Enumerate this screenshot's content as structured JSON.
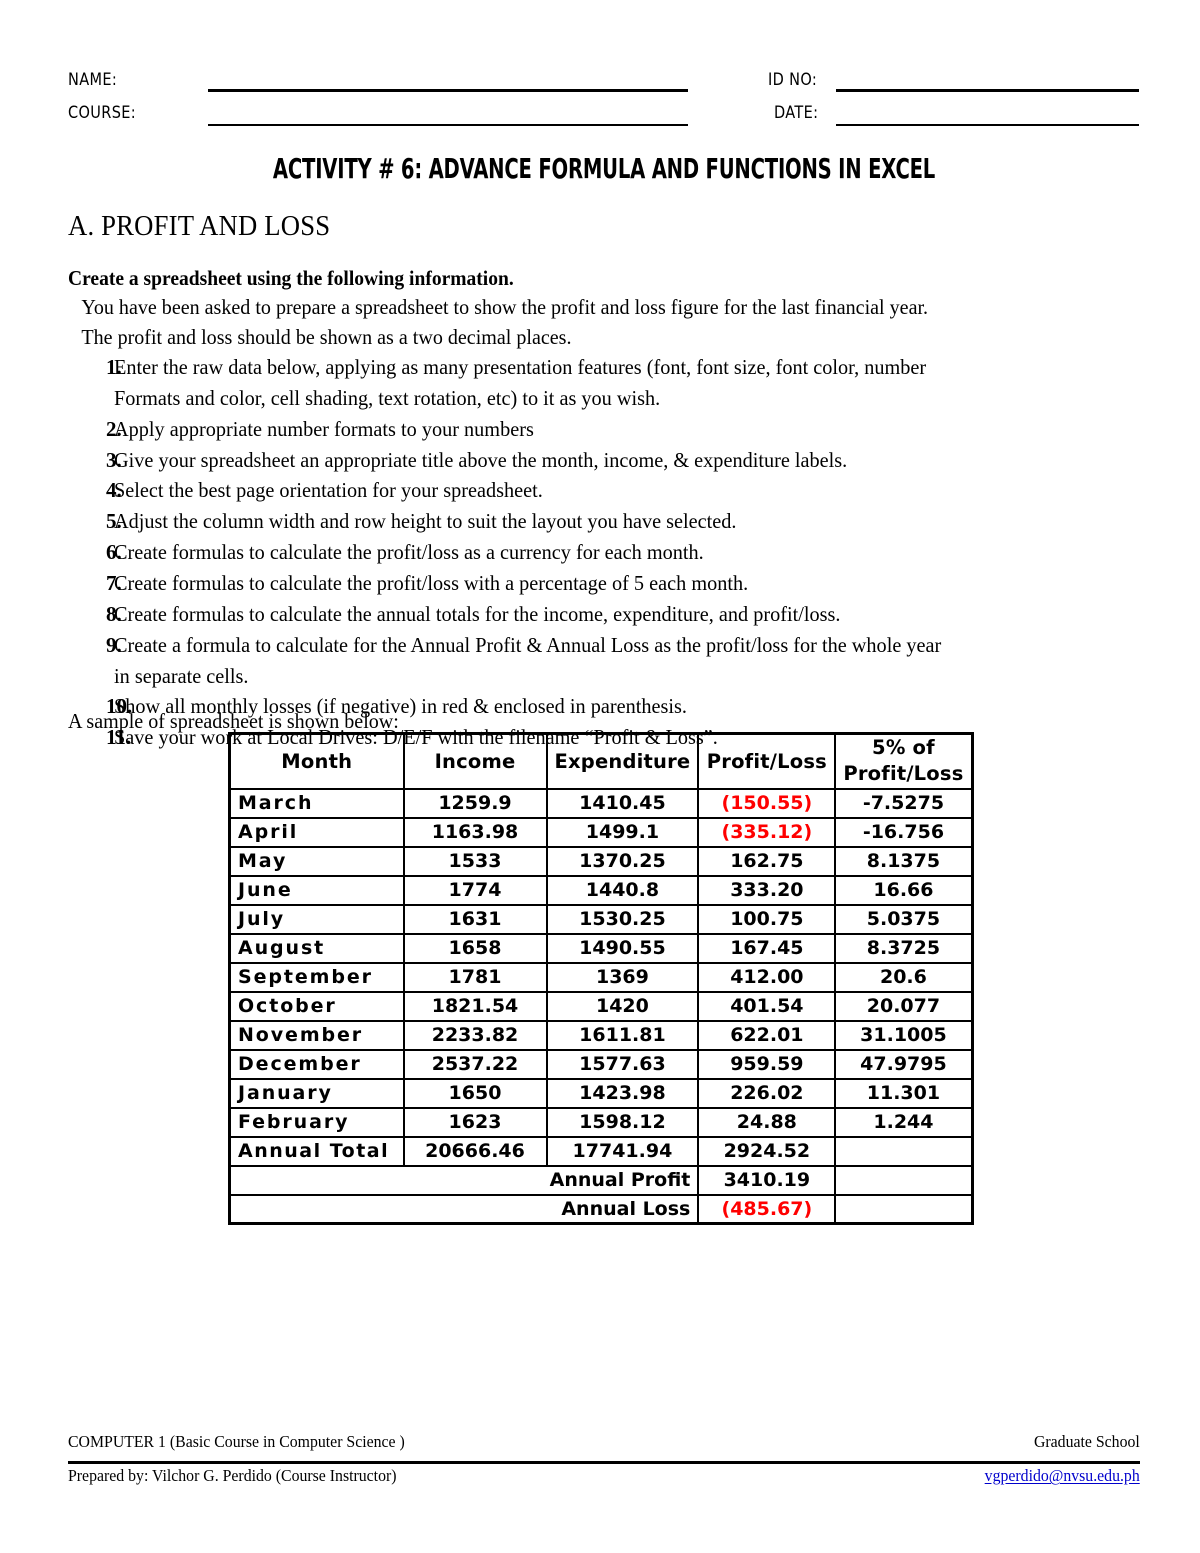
{
  "header": {
    "name_label": "NAME:",
    "course_label": "COURSE:",
    "id_label": "ID NO:",
    "date_label": "DATE:",
    "name_value": "",
    "course_value": "",
    "id_value": "",
    "date_value": ""
  },
  "activity_title": "ACTIVITY # 6: ADVANCE FORMULA AND FUNCTIONS IN EXCEL",
  "section_heading": "A. PROFIT AND LOSS",
  "intro": {
    "heading": "Create a spreadsheet using the following information.",
    "line1": "You have been asked to prepare a spreadsheet to show the profit and loss figure for the last financial year.",
    "line2": "The profit and loss should be shown as a two decimal places."
  },
  "steps": [
    {
      "num": "1.",
      "text": "Enter the raw data below, applying as many presentation features (font, font size, font color, number",
      "cont": "Formats and color, cell shading, text rotation, etc) to it as you wish."
    },
    {
      "num": "2.",
      "text": "Apply appropriate number formats to your numbers",
      "cont": ""
    },
    {
      "num": "3.",
      "text": "Give your spreadsheet an appropriate title above the month, income, & expenditure labels.",
      "cont": ""
    },
    {
      "num": "4.",
      "text": "Select the best page orientation for your spreadsheet.",
      "cont": ""
    },
    {
      "num": "5.",
      "text": "Adjust the column width and row height to suit the layout you have selected.",
      "cont": ""
    },
    {
      "num": "6.",
      "text": "Create formulas to calculate the profit/loss as a currency for each month.",
      "cont": ""
    },
    {
      "num": "7.",
      "text": "Create formulas to calculate the profit/loss with a percentage of 5 each month.",
      "cont": ""
    },
    {
      "num": "8.",
      "text": "Create formulas to calculate the annual totals for the income, expenditure, and profit/loss.",
      "cont": ""
    },
    {
      "num": "9.",
      "text": "Create a formula to calculate for the Annual Profit & Annual Loss as the profit/loss for the whole year",
      "cont": "in separate cells."
    },
    {
      "num": "10.",
      "text": "Show all monthly losses (if negative) in red & enclosed in parenthesis.",
      "cont": ""
    },
    {
      "num": "11.",
      "text": "Save your work at Local Drives: D/E/F with the filename “Profit & Loss”.",
      "cont": ""
    }
  ],
  "sample_caption": "A sample of spreadsheet is shown below:",
  "table": {
    "headers": {
      "month": "Month",
      "income": "Income",
      "expenditure": "Expenditure",
      "profit_loss": "Profit/Loss",
      "pct_line1": "5% of",
      "pct_line2": "Profit/Loss"
    },
    "rows": [
      {
        "month": "March",
        "income": "1259.9",
        "expenditure": "1410.45",
        "profit_loss": "(150.55)",
        "negative": true,
        "pct": "-7.5275"
      },
      {
        "month": "April",
        "income": "1163.98",
        "expenditure": "1499.1",
        "profit_loss": "(335.12)",
        "negative": true,
        "pct": "-16.756"
      },
      {
        "month": "May",
        "income": "1533",
        "expenditure": "1370.25",
        "profit_loss": "162.75",
        "negative": false,
        "pct": "8.1375"
      },
      {
        "month": "June",
        "income": "1774",
        "expenditure": "1440.8",
        "profit_loss": "333.20",
        "negative": false,
        "pct": "16.66"
      },
      {
        "month": "July",
        "income": "1631",
        "expenditure": "1530.25",
        "profit_loss": "100.75",
        "negative": false,
        "pct": "5.0375"
      },
      {
        "month": "August",
        "income": "1658",
        "expenditure": "1490.55",
        "profit_loss": "167.45",
        "negative": false,
        "pct": "8.3725"
      },
      {
        "month": "September",
        "income": "1781",
        "expenditure": "1369",
        "profit_loss": "412.00",
        "negative": false,
        "pct": "20.6"
      },
      {
        "month": "October",
        "income": "1821.54",
        "expenditure": "1420",
        "profit_loss": "401.54",
        "negative": false,
        "pct": "20.077"
      },
      {
        "month": "November",
        "income": "2233.82",
        "expenditure": "1611.81",
        "profit_loss": "622.01",
        "negative": false,
        "pct": "31.1005"
      },
      {
        "month": "December",
        "income": "2537.22",
        "expenditure": "1577.63",
        "profit_loss": "959.59",
        "negative": false,
        "pct": "47.9795"
      },
      {
        "month": "January",
        "income": "1650",
        "expenditure": "1423.98",
        "profit_loss": "226.02",
        "negative": false,
        "pct": "11.301"
      },
      {
        "month": "February",
        "income": "1623",
        "expenditure": "1598.12",
        "profit_loss": "24.88",
        "negative": false,
        "pct": "1.244"
      }
    ],
    "annual_total": {
      "label": "Annual Total",
      "income": "20666.46",
      "expenditure": "17741.94",
      "profit_loss": "2924.52",
      "pct": ""
    },
    "annual_profit": {
      "label": "Annual Profit",
      "value": "3410.19",
      "negative": false,
      "pct": ""
    },
    "annual_loss": {
      "label": "Annual Loss",
      "value": "(485.67)",
      "negative": true,
      "pct": ""
    }
  },
  "footer": {
    "course_code": "COMPUTER 1 (Basic Course in Computer Science )",
    "department": "Graduate School",
    "prepared_by": "Prepared by: Vilchor G. Perdido (Course Instructor)",
    "email": "vgperdido@nvsu.edu.ph"
  },
  "colors": {
    "negative": "#FF0000",
    "link": "#0000CC",
    "text": "#000000"
  },
  "chart_data": {
    "type": "table",
    "title": "Profit and Loss",
    "columns": [
      "Month",
      "Income",
      "Expenditure",
      "Profit/Loss",
      "5% of Profit/Loss"
    ],
    "rows": [
      [
        "March",
        1259.9,
        1410.45,
        -150.55,
        -7.5275
      ],
      [
        "April",
        1163.98,
        1499.1,
        -335.12,
        -16.756
      ],
      [
        "May",
        1533,
        1370.25,
        162.75,
        8.1375
      ],
      [
        "June",
        1774,
        1440.8,
        333.2,
        16.66
      ],
      [
        "July",
        1631,
        1530.25,
        100.75,
        5.0375
      ],
      [
        "August",
        1658,
        1490.55,
        167.45,
        8.3725
      ],
      [
        "September",
        1781,
        1369,
        412.0,
        20.6
      ],
      [
        "October",
        1821.54,
        1420,
        401.54,
        20.077
      ],
      [
        "November",
        2233.82,
        1611.81,
        622.01,
        31.1005
      ],
      [
        "December",
        2537.22,
        1577.63,
        959.59,
        47.9795
      ],
      [
        "January",
        1650,
        1423.98,
        226.02,
        11.301
      ],
      [
        "February",
        1623,
        1598.12,
        24.88,
        1.244
      ]
    ],
    "annual_total": [
      "Annual Total",
      20666.46,
      17741.94,
      2924.52,
      null
    ],
    "annual_profit": 3410.19,
    "annual_loss": -485.67
  }
}
